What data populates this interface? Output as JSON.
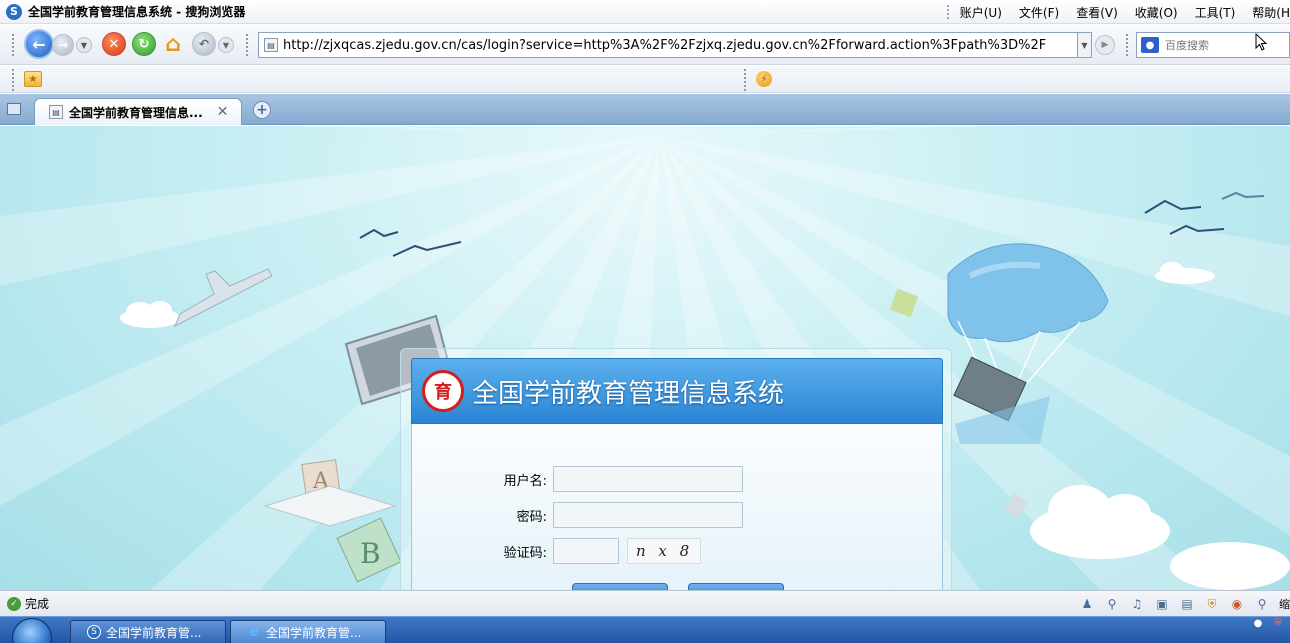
{
  "window": {
    "title": "全国学前教育管理信息系统 - 搜狗浏览器"
  },
  "menu": {
    "items": [
      "账户(U)",
      "文件(F)",
      "查看(V)",
      "收藏(O)",
      "工具(T)",
      "帮助(H"
    ]
  },
  "address_bar": {
    "url": "http://zjxqcas.zjedu.gov.cn/cas/login?service=http%3A%2F%2Fzjxq.zjedu.gov.cn%2Fforward.action%3Fpath%3D%2F"
  },
  "search": {
    "placeholder": "百度搜索"
  },
  "tabs": [
    {
      "title": "全国学前教育管理信息..."
    }
  ],
  "login": {
    "system_title": "全国学前教育管理信息系统",
    "username_label": "用户名:",
    "password_label": "密码:",
    "captcha_label": "验证码:",
    "username_value": "",
    "password_value": "",
    "captcha_value": "",
    "captcha_image_text": "n x  8"
  },
  "statusbar": {
    "status_text": "完成",
    "zoom_label": "缩"
  },
  "taskbar": {
    "items": [
      {
        "label": "全国学前教育管..."
      },
      {
        "label": "全国学前教育管..."
      }
    ]
  },
  "colors": {
    "sky_background": "#bfe9f0",
    "login_header_blue": "#3d95dc",
    "logo_red": "#d41d1d",
    "taskbar_blue": "#2f66b6"
  }
}
